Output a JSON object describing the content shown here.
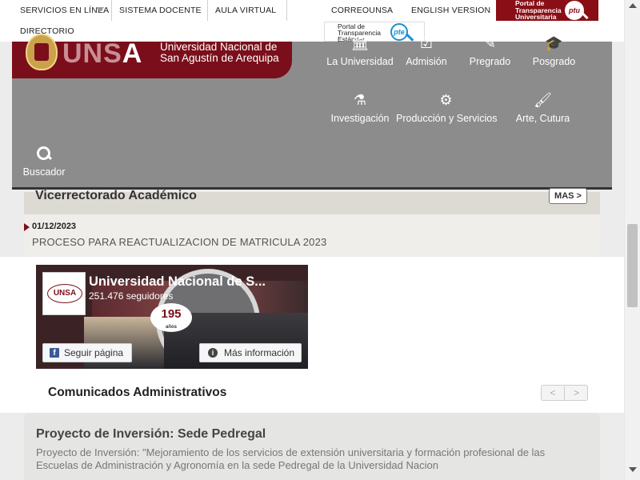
{
  "topbar": {
    "servicios": "SERVICIOS EN LÍNEA",
    "sistema": "SISTEMA DOCENTE",
    "aula": "AULA VIRTUAL",
    "correo": "CORREOUNSA",
    "english": "ENGLISH VERSION",
    "directorio": "DIRECTORIO",
    "ptu_text": "Portal de Transparencia Universitaria",
    "ptu_logo": "ptu",
    "pte_text": "Portal de Transparencia Estándar",
    "pte_logo": "pte"
  },
  "brand": {
    "wordmark_a": "UNS",
    "wordmark_b": "A",
    "name_line1": "Universidad Nacional de",
    "name_line2": "San Agustín de Arequipa"
  },
  "nav": [
    {
      "label": "La Universidad",
      "icon": "institution-icon"
    },
    {
      "label": "Admisión",
      "icon": "edit-icon"
    },
    {
      "label": "Pregrado",
      "icon": "pencil-icon"
    },
    {
      "label": "Posgrado",
      "icon": "graduation-cap-icon"
    },
    {
      "label": "Investigación",
      "icon": "flask-icon"
    },
    {
      "label": "Producción y Servicios",
      "icon": "gears-icon"
    },
    {
      "label": "Arte, Cutura",
      "icon": "brush-icon"
    }
  ],
  "search": {
    "label": "Buscador",
    "icon": "search-icon"
  },
  "vicerrectorado": {
    "title": "Vicerrectorado Académico",
    "more_label": "MAS >",
    "date": "01/12/2023",
    "item": "PROCESO PARA REACTUALIZACION DE MATRICULA 2023"
  },
  "facebook": {
    "page_name": "Universidad Nacional de S...",
    "followers": "251.476 seguidores",
    "avatar_text": "UNSA",
    "badge": "195",
    "badge_sub": "años",
    "follow_label": "Seguir página",
    "more_label": "Más información"
  },
  "comunicados": {
    "title": "Comunicados Administrativos",
    "prev": "<",
    "next": ">"
  },
  "project": {
    "title": "Proyecto de Inversión: Sede Pedregal",
    "description": "Proyecto de Inversión: \"Mejoramiento de los servicios de extensión universitaria y formación profesional de las Escuelas de Administración y Agronomía en la sede Pedregal de la Universidad Nacion"
  },
  "colors": {
    "brand_maroon": "#7a0f1b",
    "header_gray": "#8c8c8c",
    "facebook_blue": "#3b5998",
    "pte_blue": "#1b8fd3"
  }
}
